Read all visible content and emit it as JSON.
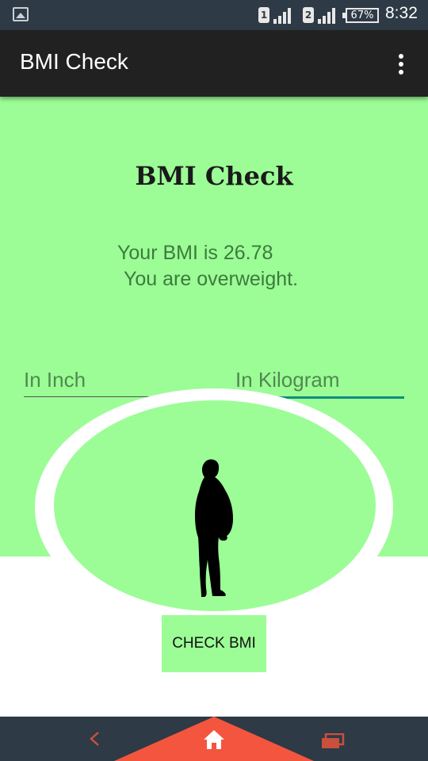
{
  "status_bar": {
    "icons": [
      "gallery-icon",
      "sim1-signal-icon",
      "sim2-signal-icon",
      "battery-icon"
    ],
    "sim1": "1",
    "sim2": "2",
    "battery": "67%",
    "time": "8:32"
  },
  "app_bar": {
    "title": "BMI Check",
    "menu_icon": "overflow-menu-icon"
  },
  "main": {
    "heading": "BMI Check",
    "result_line1": "Your BMI is 26.78",
    "result_line2": "You are overweight.",
    "height_placeholder": "In Inch",
    "weight_placeholder": "In Kilogram",
    "button_label": "CHECK BMI",
    "figure_icon": "person-silhouette-icon"
  },
  "nav_bar": {
    "icons": [
      "back-icon",
      "home-icon",
      "recent-apps-icon"
    ]
  },
  "colors": {
    "panel": "#9cfd96",
    "status_bar": "#2e3a45",
    "app_bar": "#212121",
    "accent": "#128d7d",
    "nav_accent": "#f4553f"
  }
}
